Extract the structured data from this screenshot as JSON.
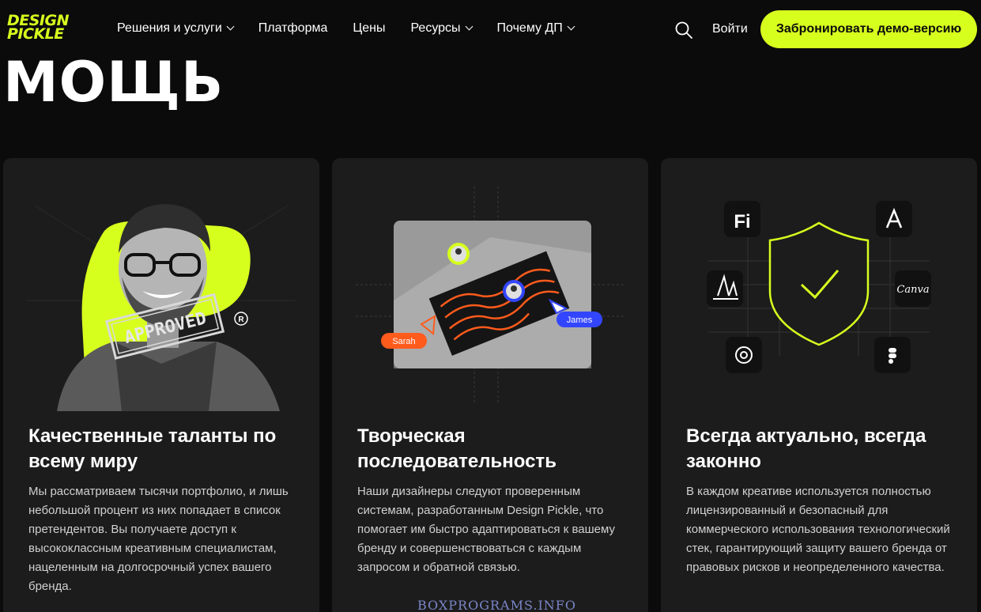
{
  "brand": {
    "logo_line1": "DESIGN",
    "logo_line2": "PICKLE",
    "accent": "#d7ff1e"
  },
  "nav": {
    "items": [
      {
        "label": "Решения и услуги",
        "dropdown": true
      },
      {
        "label": "Платформа",
        "dropdown": false
      },
      {
        "label": "Цены",
        "dropdown": false
      },
      {
        "label": "Ресурсы",
        "dropdown": true
      },
      {
        "label": "Почему ДП",
        "dropdown": true
      }
    ],
    "search_icon": "search-icon",
    "login_label": "Войти",
    "demo_label": "Забронировать демо-версию"
  },
  "hero": {
    "word": "МОЩЬ"
  },
  "cards": [
    {
      "title": "Качественные таланты по всему миру",
      "description": "Мы рассматриваем тысячи портфолио, и лишь небольшой процент из них попадает в список претендентов. Вы получаете доступ к высококлассным креативным специалистам, нацеленным на долгосрочный успех вашего бренда.",
      "stamp_text": "APPROVED"
    },
    {
      "title": "Творческая последовательность",
      "description": "Наши дизайнеры следуют проверенным системам, разработанным Design Pickle, что помогает им быстро адаптироваться к вашему бренду и совершенствоваться с каждым запросом и обратной связью.",
      "cursor_labels": [
        "Sarah",
        "James"
      ]
    },
    {
      "title": "Всегда актуально, всегда законно",
      "description": "В каждом креативе используется полностью лицензированный и безопасный для коммерческого использования технологический стек, гарантирующий защиту вашего бренда от правовых рисков и неопределенного качества.",
      "tool_icons": [
        "firefly-icon",
        "adobe-icon",
        "midjourney-icon",
        "canva-icon",
        "openai-icon",
        "figma-icon"
      ],
      "canva_label": "Canva",
      "firefly_label": "Fi"
    }
  ],
  "watermark": "BOXPROGRAMS.INFO"
}
